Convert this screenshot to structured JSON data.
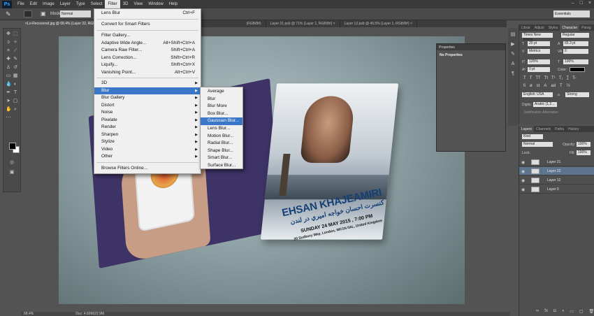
{
  "app": {
    "logo": "Ps"
  },
  "menubar": {
    "items": [
      "File",
      "Edit",
      "Image",
      "Layer",
      "Type",
      "Select",
      "Filter",
      "3D",
      "View",
      "Window",
      "Help"
    ],
    "active": "Filter"
  },
  "window_controls": [
    "–",
    "□",
    "×"
  ],
  "options": {
    "mode_label": "Mode:",
    "mode_value": "Normal",
    "workspace": "Essentials"
  },
  "tabs": [
    {
      "label": "<Lo-Recovered.jpg @ 68.4% (Layer 22, RGB/8#) ×",
      "active": true
    },
    {
      "label": "(RGB/8#)",
      "active": false
    },
    {
      "label": "Layer 21.psb @ 71% (Layer 1, RGB/8#) ×",
      "active": false
    },
    {
      "label": "Layer 12.psb @ 45.5% (Layer 1, RGB/8#) ×",
      "active": false
    }
  ],
  "filter_menu": {
    "items": [
      {
        "label": "Lens Blur",
        "shortcut": "Ctrl+F"
      },
      {
        "label": "Convert for Smart Filters"
      },
      {
        "label": "Filter Gallery..."
      },
      {
        "label": "Adaptive Wide Angle...",
        "shortcut": "Alt+Shift+Ctrl+A"
      },
      {
        "label": "Camera Raw Filter...",
        "shortcut": "Shift+Ctrl+A"
      },
      {
        "label": "Lens Correction...",
        "shortcut": "Shift+Ctrl+R"
      },
      {
        "label": "Liquify...",
        "shortcut": "Shift+Ctrl+X"
      },
      {
        "label": "Vanishing Point...",
        "shortcut": "Alt+Ctrl+V"
      },
      {
        "label": "3D"
      },
      {
        "label": "Blur",
        "highlighted": true
      },
      {
        "label": "Blur Gallery"
      },
      {
        "label": "Distort"
      },
      {
        "label": "Noise"
      },
      {
        "label": "Pixelate"
      },
      {
        "label": "Render"
      },
      {
        "label": "Sharpen"
      },
      {
        "label": "Stylize"
      },
      {
        "label": "Video"
      },
      {
        "label": "Other"
      },
      {
        "label": "Browse Filters Online..."
      }
    ]
  },
  "blur_menu": {
    "items": [
      "Average",
      "Blur",
      "Blur More",
      "Box Blur...",
      "Gaussian Blur...",
      "Lens Blur...",
      "Motion Blur...",
      "Radial Blur...",
      "Shape Blur...",
      "Smart Blur...",
      "Surface Blur..."
    ],
    "highlighted": "Gaussian Blur..."
  },
  "magazine": {
    "title": "EHSAN KHAJEAMIRI",
    "arabic": "كنسرت احسان خواجه اميري در لندن",
    "date": "SUNDAY 24 MAY 2015 , 7:00 PM",
    "address": "20 Sudbury Way, London, WC1N 0AL, United Kingdom"
  },
  "properties": {
    "title": "Properties",
    "body": "No Properties"
  },
  "character_panel": {
    "tabs": [
      "Librar",
      "Adjust",
      "Styles",
      "Character",
      "Parag"
    ],
    "active_tab": "Character",
    "font_family": "Times New Roma...",
    "font_style": "Regular",
    "size": "20 pt",
    "leading": "65.3 pt",
    "kerning": "Metrics",
    "tracking": "0",
    "vscale": "125%",
    "hscale": "100%",
    "baseline": "0 pt",
    "color_label": "Color:",
    "language": "English: USA",
    "aa_label": "a",
    "antialias": "Strong",
    "digits_label": "Digits:",
    "digits": "Arabic (1,2...",
    "justification": "Justification Alternates"
  },
  "layers_panel": {
    "tabs": [
      "Layers",
      "Channels",
      "Paths",
      "History"
    ],
    "active_tab": "Layers",
    "kind": "Kind",
    "blend": "Normal",
    "opacity_label": "Opacity:",
    "opacity": "100%",
    "lock_label": "Lock:",
    "fill_label": "Fill:",
    "fill": "100%",
    "layers": [
      {
        "name": "Layer 21",
        "selected": false
      },
      {
        "name": "Layer 22",
        "selected": true
      },
      {
        "name": "Layer 12",
        "selected": false
      },
      {
        "name": "Layer 0",
        "selected": false
      }
    ]
  },
  "status": {
    "zoom": "68.4%",
    "doc": "Doc: 4.69M/22.9M"
  }
}
